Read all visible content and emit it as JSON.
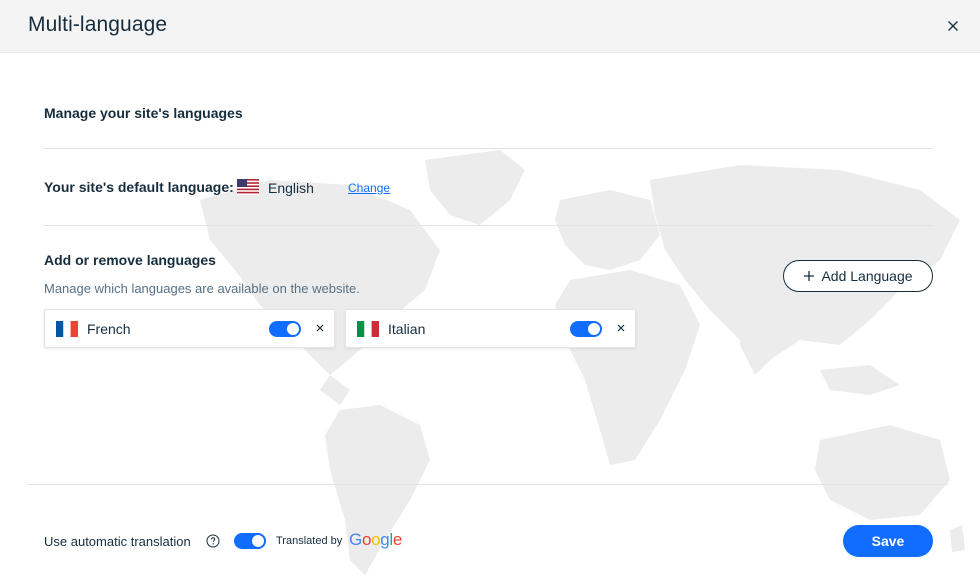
{
  "header": {
    "title": "Multi-language"
  },
  "manage": {
    "title": "Manage your site's languages"
  },
  "default_language": {
    "label": "Your site's default language:",
    "language": "English",
    "change_label": "Change"
  },
  "add_remove": {
    "title": "Add or remove languages",
    "subtitle": "Manage which languages are available on the website.",
    "add_button_label": "Add Language"
  },
  "languages": [
    {
      "name": "French",
      "enabled": true
    },
    {
      "name": "Italian",
      "enabled": true
    }
  ],
  "footer": {
    "auto_translation_label": "Use automatic translation",
    "auto_translation_enabled": true,
    "translated_by_label": "Translated by",
    "google_letters": [
      "G",
      "o",
      "o",
      "g",
      "l",
      "e"
    ],
    "save_label": "Save"
  },
  "colors": {
    "accent": "#116dff",
    "text": "#162d3d",
    "header_bg": "#f4f4f5",
    "map": "#ececec"
  },
  "icons": [
    "close-icon",
    "us-flag-icon",
    "plus-icon",
    "french-flag-icon",
    "italian-flag-icon",
    "remove-icon",
    "help-icon",
    "google-logo"
  ]
}
